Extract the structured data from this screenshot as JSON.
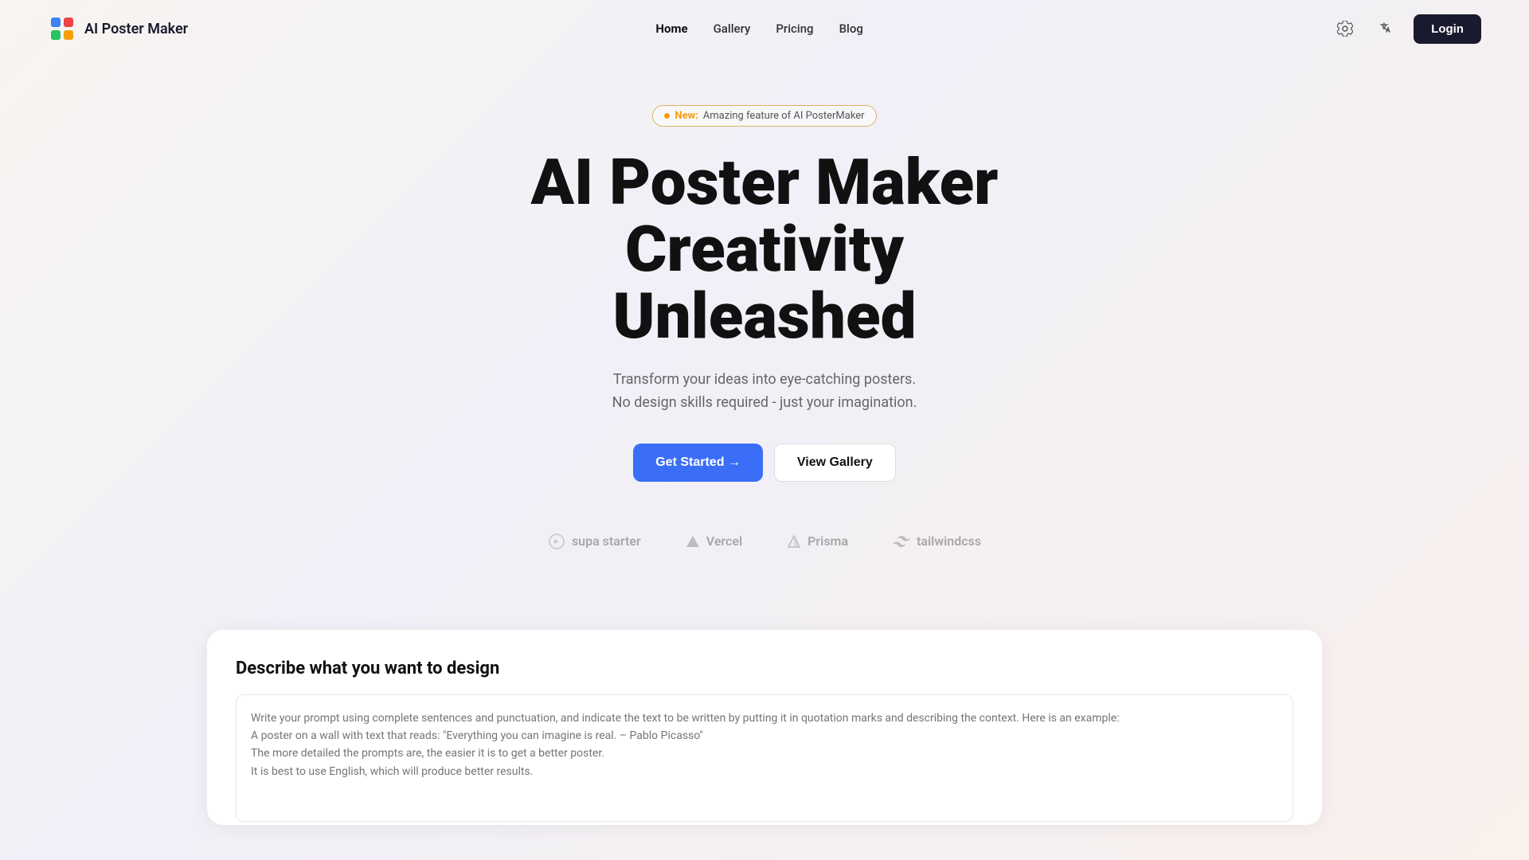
{
  "brand": {
    "name": "AI Poster Maker"
  },
  "navbar": {
    "links": [
      {
        "label": "Home",
        "active": true
      },
      {
        "label": "Gallery",
        "active": false
      },
      {
        "label": "Pricing",
        "active": false
      },
      {
        "label": "Blog",
        "active": false
      }
    ],
    "login_label": "Login"
  },
  "hero": {
    "badge_new": "New:",
    "badge_text": "Amazing feature of AI PosterMaker",
    "title_line1": "AI Poster Maker",
    "title_line2": "Creativity",
    "title_line3": "Unleashed",
    "subtitle_line1": "Transform your ideas into eye-catching posters.",
    "subtitle_line2": "No design skills required - just your imagination.",
    "cta_primary": "Get Started →",
    "cta_secondary": "View Gallery"
  },
  "logos": [
    {
      "name": "supastarter",
      "text": "supa starter"
    },
    {
      "name": "vercel",
      "text": "▲  Vercel"
    },
    {
      "name": "prisma",
      "text": "◇  Prisma"
    },
    {
      "name": "tailwindcss",
      "text": "〜  tailwindcss"
    }
  ],
  "design_section": {
    "title": "Describe what you want to design",
    "placeholder": "Write your prompt using complete sentences and punctuation, and indicate the text to be written by putting it in quotation marks and describing the context. Here is an example:\nA poster on a wall with text that reads: \"Everything you can imagine is real. – Pablo Picasso\"\nThe more detailed the prompts are, the easier it is to get a better poster.\nIt is best to use English, which will produce better results."
  }
}
